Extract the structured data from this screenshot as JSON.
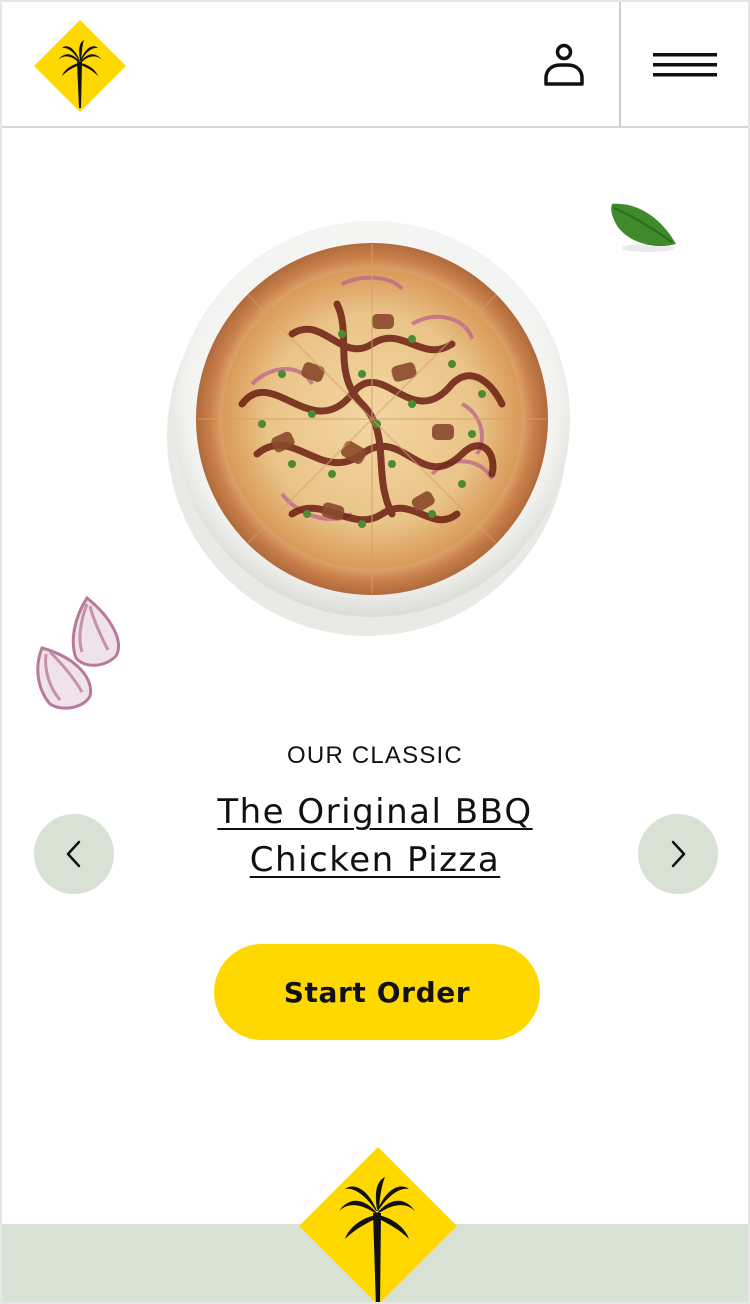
{
  "header": {
    "logo_icon": "palm-tree-diamond-logo",
    "account_icon": "user-account-icon",
    "menu_icon": "hamburger-menu-icon"
  },
  "hero": {
    "eyebrow": "OUR CLASSIC",
    "product_title": "The Original BBQ Chicken Pizza",
    "image_icon": "bbq-chicken-pizza-image",
    "garnish_icons": [
      "basil-leaf-icon",
      "red-onion-icon"
    ]
  },
  "carousel": {
    "prev_icon": "chevron-left-icon",
    "next_icon": "chevron-right-icon"
  },
  "cta": {
    "start_order_label": "Start Order"
  },
  "footer": {
    "logo_icon": "palm-tree-diamond-logo"
  },
  "colors": {
    "brand_yellow": "#ffd800",
    "sage": "#d8e2d4",
    "text": "#111111"
  }
}
